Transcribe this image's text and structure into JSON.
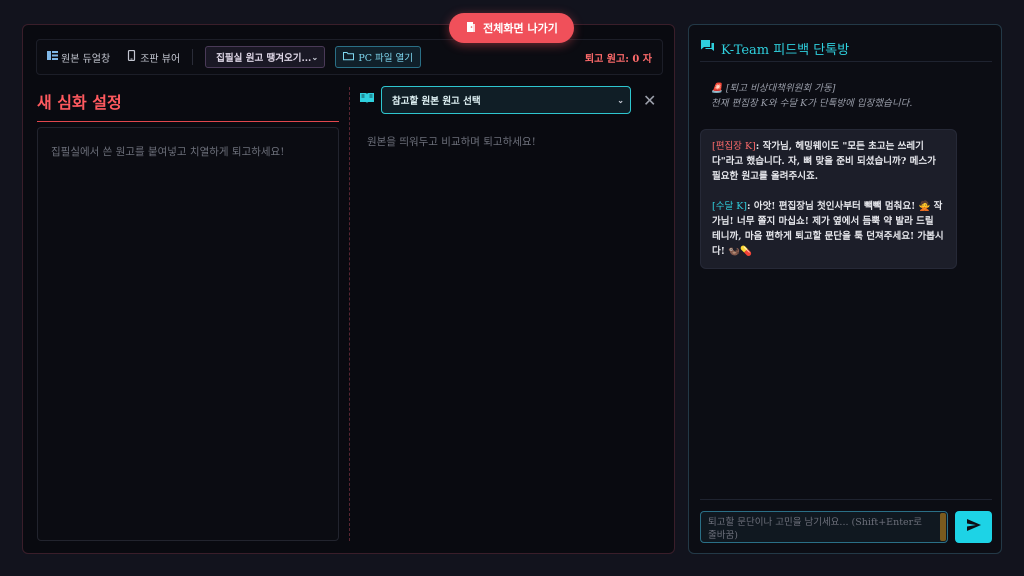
{
  "exit_fullscreen": {
    "label": "전체화면 나가기",
    "icon": "door-exit-icon"
  },
  "toolbar": {
    "dual_view": {
      "label": "원본 듀얼창",
      "icon": "columns-icon"
    },
    "layout_viewer": {
      "label": "조판 뷰어",
      "icon": "phone-icon"
    },
    "load_select": {
      "value": "집필실 원고 땡겨오기..."
    },
    "pc_open": {
      "label": "PC 파일 열기",
      "icon": "folder-icon"
    },
    "count_text": "퇴고 원고: 0 자"
  },
  "editor": {
    "title": "새 심화 설정",
    "placeholder": "집필실에서 쓴 원고를 붙여넣고 치열하게 퇴고하세요!"
  },
  "reference": {
    "icon": "book-icon",
    "select_value": "참고할 원본 원고 선택",
    "placeholder": "원본을 띄워두고 비교하며 퇴고하세요!"
  },
  "chat": {
    "title": "K-Team 피드백 단톡방",
    "header_icon": "chat-bubbles-icon",
    "system_line1": "🚨 [퇴고 비상대책위원회 가동]",
    "system_line2": "천재 편집장 K와 수달 K가 단톡방에 입장했습니다.",
    "messages": [
      {
        "speaker": "[편집장 K]",
        "text": ": 작가님, 헤밍웨이도 \"모든 초고는 쓰레기다\"라고 했습니다. 자, 뼈 맞을 준비 되셨습니까? 메스가 필요한 원고를 올려주시죠."
      },
      {
        "speaker": "[수달 K]",
        "text": ": 아앗! 편집장님 첫인사부터 빽빽 멈춰요! 🙅 작가님! 너무 쫄지 마십쇼! 제가 옆에서 듬뿍 약 발라 드릴 테니까, 마음 편하게 퇴고할 문단을 툭 던져주세요! 가봅시다! 🦦💊"
      }
    ],
    "input_placeholder": "퇴고할 문단이나 고민을 남기세요... (Shift+Enter로 줄바꿈)",
    "send_icon": "send-icon"
  },
  "colors": {
    "accent_red": "#f0505a",
    "accent_cyan": "#2fd0de",
    "background": "#12131d"
  }
}
